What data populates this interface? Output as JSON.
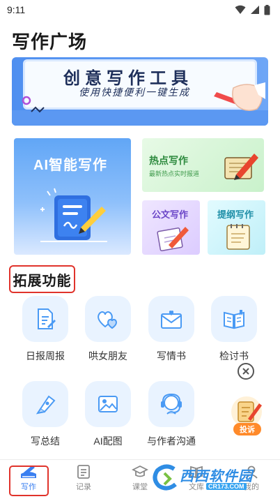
{
  "status_bar": {
    "time": "9:11"
  },
  "page_title": "写作广场",
  "banner": {
    "title": "创意写作工具",
    "subtitle": "使用快捷便利一键生成"
  },
  "cards": {
    "ai_writing": {
      "title": "AI智能写作"
    },
    "hot_writing": {
      "title": "热点写作",
      "subtitle": "最新热点实时报道"
    },
    "official_writing": {
      "title": "公文写作"
    },
    "outline_writing": {
      "title": "提纲写作"
    }
  },
  "section": {
    "title": "拓展功能"
  },
  "features": [
    {
      "label": "日报周报",
      "icon": "report-doc-icon"
    },
    {
      "label": "哄女朋友",
      "icon": "hearts-icon"
    },
    {
      "label": "写情书",
      "icon": "love-letter-icon"
    },
    {
      "label": "检讨书",
      "icon": "open-book-icon"
    },
    {
      "label": "写总结",
      "icon": "pen-nib-icon"
    },
    {
      "label": "AI配图",
      "icon": "image-icon"
    },
    {
      "label": "与作者沟通",
      "icon": "headset-icon"
    }
  ],
  "report_float": {
    "label": "投诉"
  },
  "bottom_nav": {
    "items": [
      {
        "label": "写作",
        "active": true
      },
      {
        "label": "记录",
        "active": false
      },
      {
        "label": "课堂",
        "active": false
      },
      {
        "label": "文库",
        "active": false
      },
      {
        "label": "我的",
        "active": false
      }
    ]
  },
  "watermark": {
    "text": "西西软件园",
    "url": "CR173.COM"
  },
  "colors": {
    "accent": "#3a7ff0",
    "highlight_border": "#e0332b",
    "icon_tile": "#e9f3ff",
    "icon_stroke": "#4a9af4"
  }
}
